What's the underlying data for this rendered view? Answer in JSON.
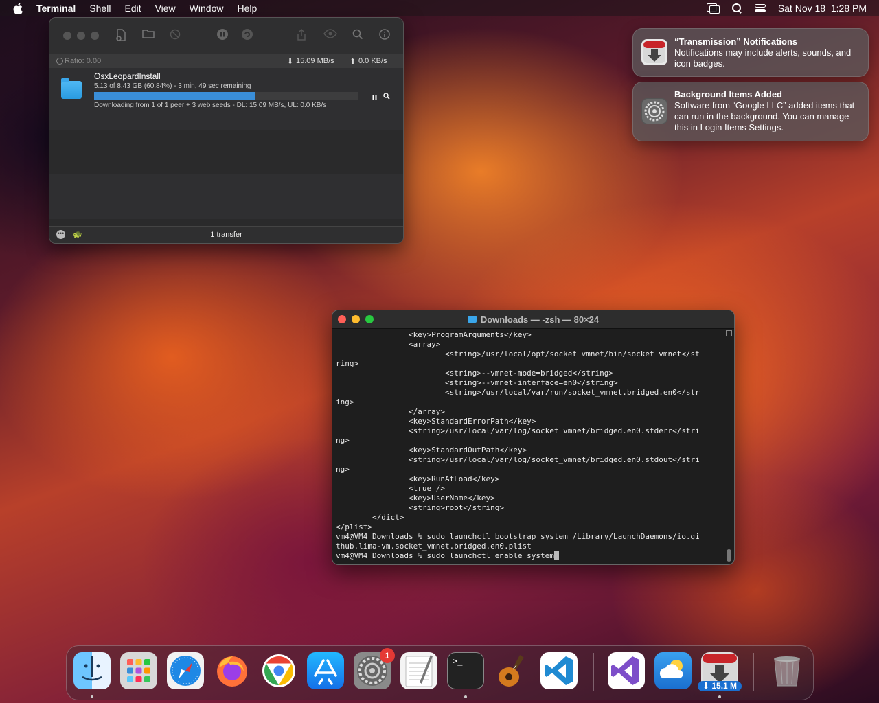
{
  "menubar": {
    "app_name": "Terminal",
    "menus": [
      "Shell",
      "Edit",
      "View",
      "Window",
      "Help"
    ],
    "datetime": "Sat Nov 18  1:28 PM"
  },
  "transmission": {
    "ratio": "Ratio: 0.00",
    "download_speed": "15.09 MB/s",
    "upload_speed": "0.0 KB/s",
    "torrent": {
      "name": "OsxLeopardInstall",
      "progress_text": "5.13 of 8.43 GB (60.84%) - 3 min, 49 sec remaining",
      "progress_fraction": 0.6084,
      "status": "Downloading from 1 of 1 peer + 3 web seeds - DL: 15.09 MB/s, UL: 0.0 KB/s"
    },
    "footer": "1 transfer"
  },
  "notifications": [
    {
      "title": "“Transmission” Notifications",
      "body": "Notifications may include alerts, sounds, and icon badges."
    },
    {
      "title": "Background Items Added",
      "body": "Software from “Google LLC” added items that can run in the background. You can manage this in Login Items Settings."
    }
  ],
  "terminal": {
    "title": "Downloads — -zsh — 80×24",
    "lines": [
      "                <key>ProgramArguments</key>",
      "                <array>",
      "                        <string>/usr/local/opt/socket_vmnet/bin/socket_vmnet</st",
      "ring>",
      "                        <string>--vmnet-mode=bridged</string>",
      "                        <string>--vmnet-interface=en0</string>",
      "                        <string>/usr/local/var/run/socket_vmnet.bridged.en0</str",
      "ing>",
      "                </array>",
      "                <key>StandardErrorPath</key>",
      "                <string>/usr/local/var/log/socket_vmnet/bridged.en0.stderr</stri",
      "ng>",
      "                <key>StandardOutPath</key>",
      "                <string>/usr/local/var/log/socket_vmnet/bridged.en0.stdout</stri",
      "ng>",
      "                <key>RunAtLoad</key>",
      "                <true />",
      "                <key>UserName</key>",
      "                <string>root</string>",
      "        </dict>",
      "</plist>",
      "vm4@VM4 Downloads % sudo launchctl bootstrap system /Library/LaunchDaemons/io.gi",
      "thub.lima-vm.socket_vmnet.bridged.en0.plist"
    ],
    "prompt_line": "vm4@VM4 Downloads % sudo launchctl enable system"
  },
  "dock": {
    "system_settings_badge": "1",
    "transmission_badge": "15.1 M",
    "apps": [
      "finder",
      "launchpad",
      "safari",
      "firefox",
      "chrome",
      "app-store",
      "system-settings",
      "textedit",
      "terminal",
      "garageband",
      "vscode",
      "visual-studio",
      "weather",
      "transmission",
      "trash"
    ]
  }
}
